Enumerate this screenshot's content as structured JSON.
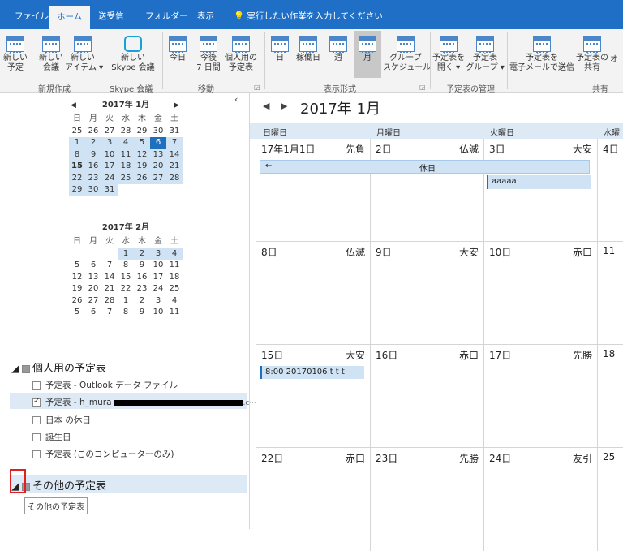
{
  "tabs": [
    "ファイル",
    "ホーム",
    "送受信",
    "フォルダー",
    "表示"
  ],
  "tell_me": "実行したい作業を入力してください",
  "ribbon": {
    "buttons": [
      {
        "l1": "新しい",
        "l2": "予定"
      },
      {
        "l1": "新しい",
        "l2": "会議"
      },
      {
        "l1": "新しい",
        "l2": "アイテム ▾"
      },
      {
        "l1": "新しい",
        "l2": "Skype 会議"
      },
      {
        "l1": "今日",
        "l2": ""
      },
      {
        "l1": "今後",
        "l2": "7 日間"
      },
      {
        "l1": "個人用の",
        "l2": "予定表"
      },
      {
        "l1": "日",
        "l2": ""
      },
      {
        "l1": "稼働日",
        "l2": ""
      },
      {
        "l1": "週",
        "l2": ""
      },
      {
        "l1": "月",
        "l2": ""
      },
      {
        "l1": "グループ",
        "l2": "スケジュール"
      },
      {
        "l1": "予定表を",
        "l2": "開く ▾"
      },
      {
        "l1": "予定表",
        "l2": "グループ ▾"
      },
      {
        "l1": "予定表を",
        "l2": "電子メールで送信"
      },
      {
        "l1": "予定表の",
        "l2": "共有"
      },
      {
        "l1": "オ",
        "l2": ""
      }
    ],
    "groups": [
      "新規作成",
      "Skype 会議",
      "移動",
      "表示形式",
      "予定表の管理",
      "共有"
    ]
  },
  "mini1": {
    "title": "2017年 1月",
    "dow": [
      "日",
      "月",
      "火",
      "水",
      "木",
      "金",
      "土"
    ],
    "weeks": [
      [
        "25",
        "26",
        "27",
        "28",
        "29",
        "30",
        "31"
      ],
      [
        "1",
        "2",
        "3",
        "4",
        "5",
        "6",
        "7"
      ],
      [
        "8",
        "9",
        "10",
        "11",
        "12",
        "13",
        "14"
      ],
      [
        "15",
        "16",
        "17",
        "18",
        "19",
        "20",
        "21"
      ],
      [
        "22",
        "23",
        "24",
        "25",
        "26",
        "27",
        "28"
      ],
      [
        "29",
        "30",
        "31",
        "",
        "",
        "",
        ""
      ]
    ]
  },
  "mini2": {
    "title": "2017年 2月",
    "dow": [
      "日",
      "月",
      "火",
      "水",
      "木",
      "金",
      "土"
    ],
    "weeks": [
      [
        "",
        "",
        "",
        "1",
        "2",
        "3",
        "4"
      ],
      [
        "5",
        "6",
        "7",
        "8",
        "9",
        "10",
        "11"
      ],
      [
        "12",
        "13",
        "14",
        "15",
        "16",
        "17",
        "18"
      ],
      [
        "19",
        "20",
        "21",
        "22",
        "23",
        "24",
        "25"
      ],
      [
        "26",
        "27",
        "28",
        "1",
        "2",
        "3",
        "4"
      ],
      [
        "5",
        "6",
        "7",
        "8",
        "9",
        "10",
        "11"
      ]
    ]
  },
  "my_calendars": {
    "title": "個人用の予定表",
    "items": [
      {
        "label": "予定表 - Outlook データ ファイル",
        "checked": false
      },
      {
        "label": "予定表 - h_mura",
        "checked": true
      },
      {
        "label": "日本 の休日",
        "checked": false
      },
      {
        "label": "誕生日",
        "checked": false
      },
      {
        "label": "予定表 (このコンピューターのみ)",
        "checked": false
      }
    ]
  },
  "other_calendars": {
    "title": "その他の予定表"
  },
  "tooltip": "その他の予定表",
  "main": {
    "month_title": "2017年 1月",
    "dow_headers": [
      "日曜日",
      "月曜日",
      "火曜日",
      "水曜"
    ],
    "weeks": [
      [
        {
          "d": "17年1月1日",
          "r": "先負"
        },
        {
          "d": "2日",
          "r": "仏滅"
        },
        {
          "d": "3日",
          "r": "大安"
        },
        {
          "d": "4日",
          "r": ""
        }
      ],
      [
        {
          "d": "8日",
          "r": "仏滅"
        },
        {
          "d": "9日",
          "r": "大安"
        },
        {
          "d": "10日",
          "r": "赤口"
        },
        {
          "d": "11",
          "r": ""
        }
      ],
      [
        {
          "d": "15日",
          "r": "大安"
        },
        {
          "d": "16日",
          "r": "赤口"
        },
        {
          "d": "17日",
          "r": "先勝"
        },
        {
          "d": "18",
          "r": ""
        }
      ],
      [
        {
          "d": "22日",
          "r": "赤口"
        },
        {
          "d": "23日",
          "r": "先勝"
        },
        {
          "d": "24日",
          "r": "友引"
        },
        {
          "d": "25",
          "r": ""
        }
      ]
    ],
    "events": {
      "holiday": "休日",
      "aaaaa": "aaaaa",
      "meeting": "8:00 20170106 t t t"
    }
  }
}
